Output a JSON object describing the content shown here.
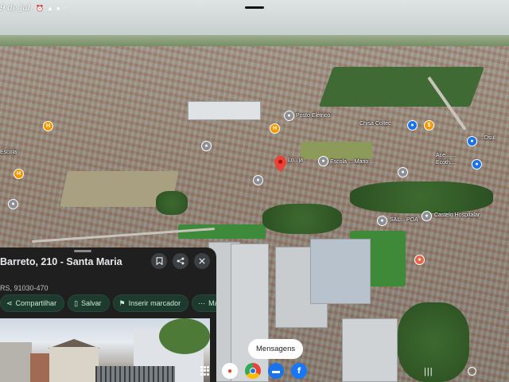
{
  "status_bar": {
    "time": "9 de jul.",
    "icons": [
      "alarm-icon",
      "warning-icon",
      "google-one-icon",
      "dot-icon"
    ]
  },
  "map": {
    "labels": [
      "Posto Elétrico",
      "Chisa Coltec",
      "Escola ... Mario ...",
      "Ecoth...",
      "...Dsul",
      "Ace... ...",
      "Castelo Hospitalar",
      "SAL... POA",
      "Escola",
      "Lo...ja"
    ],
    "poi_icons": [
      "hospital-icon",
      "shopping-icon",
      "pin-icon"
    ],
    "accent_red_pin": "#ea4335"
  },
  "place_card": {
    "title": "Barreto, 210 - Santa Maria",
    "subtitle": "RS, 91030-470",
    "actions": {
      "save_icon": "bookmark-icon",
      "share_icon": "share-icon",
      "close_icon": "close-icon"
    },
    "chips": [
      {
        "label": "Compartilhar",
        "icon": "share-icon"
      },
      {
        "label": "Salvar",
        "icon": "bookmark-icon"
      },
      {
        "label": "Inserir marcador",
        "icon": "flag-icon"
      },
      {
        "label": "Ma",
        "icon": "more-icon"
      }
    ],
    "chip_color": "#1e3a2f"
  },
  "dock": {
    "tooltip": "Mensagens",
    "apps": [
      {
        "name": "Maps",
        "icon": "maps-icon",
        "color": "#ffffff"
      },
      {
        "name": "Chrome",
        "icon": "chrome-icon",
        "color": "#ffffff"
      },
      {
        "name": "Mensagens",
        "icon": "messages-icon",
        "color": "#1a73e8"
      },
      {
        "name": "Facebook",
        "icon": "facebook-icon",
        "color": "#1877f2"
      }
    ]
  }
}
